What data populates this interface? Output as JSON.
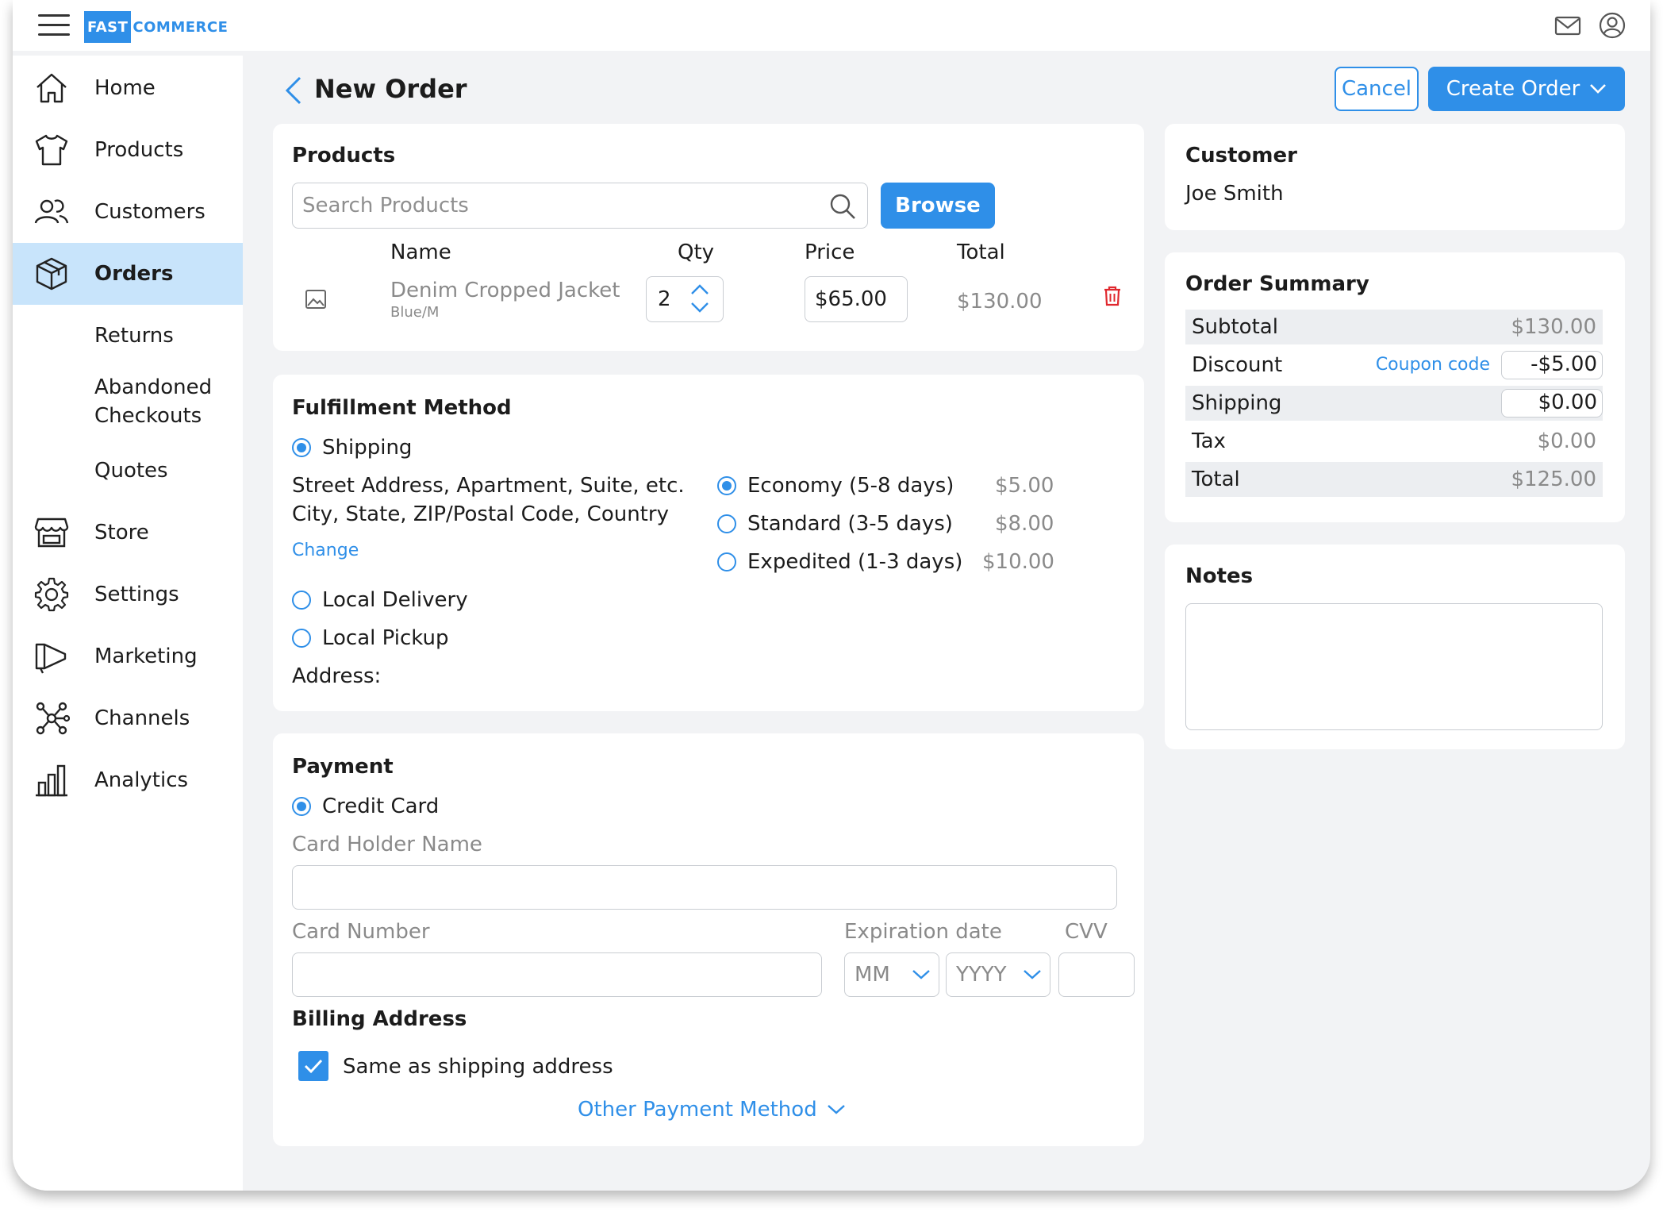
{
  "app": {
    "logo_box": "FAST",
    "logo_rest": "COMMERCE"
  },
  "nav": {
    "home": "Home",
    "products": "Products",
    "customers": "Customers",
    "orders": "Orders",
    "returns": "Returns",
    "abandoned_line1": "Abandoned",
    "abandoned_line2": "Checkouts",
    "quotes": "Quotes",
    "store": "Store",
    "settings": "Settings",
    "marketing": "Marketing",
    "channels": "Channels",
    "analytics": "Analytics"
  },
  "header": {
    "title": "New Order",
    "cancel_label": "Cancel",
    "create_label": "Create Order"
  },
  "products": {
    "title": "Products",
    "search_placeholder": "Search Products",
    "browse_label": "Browse",
    "col_name": "Name",
    "col_qty": "Qty",
    "col_price": "Price",
    "col_total": "Total",
    "item": {
      "name": "Denim Cropped Jacket",
      "variant": "Blue/M",
      "qty": "2",
      "price": "$65.00",
      "total": "$130.00"
    }
  },
  "fulfillment": {
    "title": "Fulfillment Method",
    "shipping_label": "Shipping",
    "address_line1": "Street Address, Apartment, Suite, etc.",
    "address_line2": "City, State, ZIP/Postal Code, Country",
    "change_label": "Change",
    "options": [
      {
        "label": "Economy (5-8 days)",
        "price": "$5.00",
        "selected": true
      },
      {
        "label": "Standard (3-5 days)",
        "price": "$8.00",
        "selected": false
      },
      {
        "label": "Expedited (1-3 days)",
        "price": "$10.00",
        "selected": false
      }
    ],
    "local_delivery_label": "Local Delivery",
    "local_pickup_label": "Local Pickup",
    "address_label": "Address:"
  },
  "payment": {
    "title": "Payment",
    "credit_card_label": "Credit Card",
    "card_holder_label": "Card Holder Name",
    "card_number_label": "Card Number",
    "expiration_label": "Expiration date",
    "cvv_label": "CVV",
    "month_placeholder": "MM",
    "year_placeholder": "YYYY",
    "billing_title": "Billing Address",
    "same_as_shipping_label": "Same as shipping address",
    "other_method_label": "Other Payment Method"
  },
  "customer": {
    "title": "Customer",
    "name": "Joe Smith"
  },
  "summary": {
    "title": "Order Summary",
    "subtotal_label": "Subtotal",
    "subtotal_value": "$130.00",
    "discount_label": "Discount",
    "coupon_label": "Coupon code",
    "discount_value": "-$5.00",
    "shipping_label": "Shipping",
    "shipping_value": "$0.00",
    "tax_label": "Tax",
    "tax_value": "$0.00",
    "total_label": "Total",
    "total_value": "$125.00"
  },
  "notes": {
    "title": "Notes"
  },
  "colors": {
    "accent": "#2f8fe8",
    "active_nav": "#c8e4fb",
    "delete": "#e0282e"
  }
}
